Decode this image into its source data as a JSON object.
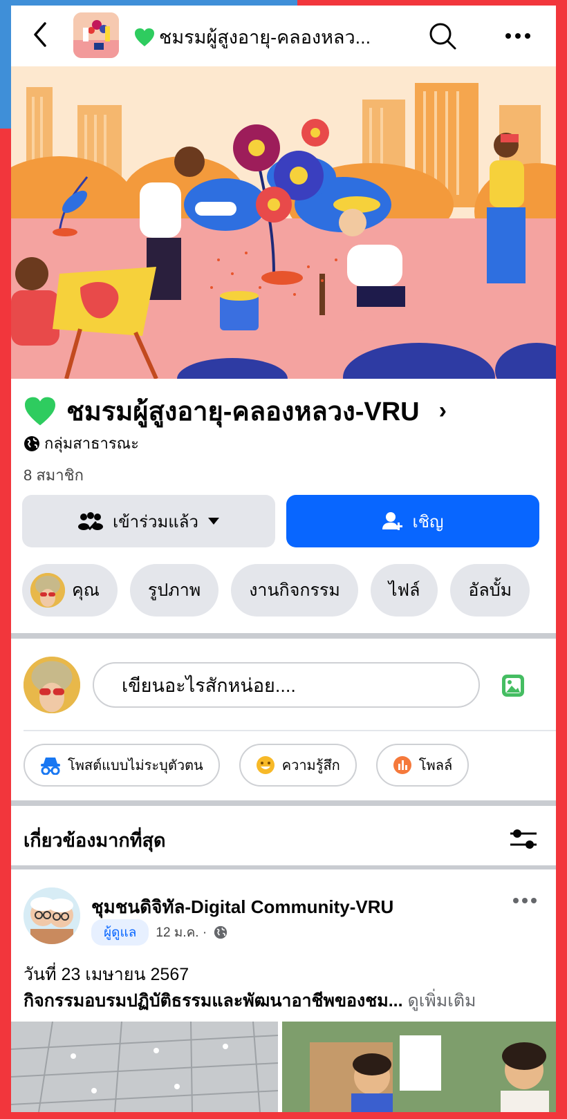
{
  "topbar": {
    "title": "ชมรมผู้สูงอายุ-คลองหลว...",
    "back_icon": "chevron-left-icon",
    "search_icon": "search-icon",
    "more_icon": "more-horizontal-icon"
  },
  "group": {
    "name": "ชมรมผู้สูงอายุ-คลองหลวง-VRU",
    "chevron": "›",
    "privacy": "กลุ่มสาธารณะ",
    "members": "8 สมาชิก",
    "heart_color": "#2ecc5f"
  },
  "buttons": {
    "joined_label": "เข้าร่วมแล้ว",
    "invite_label": "เชิญ"
  },
  "chips": [
    {
      "label": "คุณ"
    },
    {
      "label": "รูปภาพ"
    },
    {
      "label": "งานกิจกรรม"
    },
    {
      "label": "ไฟล์"
    },
    {
      "label": "อัลบั้ม"
    }
  ],
  "composer": {
    "placeholder": "เขียนอะไรสักหน่อย...."
  },
  "post_actions": [
    {
      "label": "โพสต์แบบไม่ระบุตัวตน",
      "icon": "anonymous-icon"
    },
    {
      "label": "ความรู้สึก",
      "icon": "smiley-icon"
    },
    {
      "label": "โพลล์",
      "icon": "poll-icon"
    }
  ],
  "feed": {
    "sort_label": "เกี่ยวข้องมากที่สุด",
    "filter_icon": "sliders-icon"
  },
  "post": {
    "author": "ชุมชนดิจิทัล-Digital Community-VRU",
    "badge": "ผู้ดูแล",
    "date": "12 ม.ค. ·",
    "line1": "วันที่ 23 เมษายน 2567",
    "line2": "กิจกรรมอบรมปฏิบัติธรรมและพัฒนาอาชีพของชม...",
    "see_more": "ดูเพิ่มเติม"
  },
  "colors": {
    "primary": "#0866ff",
    "frame": "#f2363c",
    "frame_accent": "#3f8fd8",
    "button_gray": "#e4e6eb"
  }
}
